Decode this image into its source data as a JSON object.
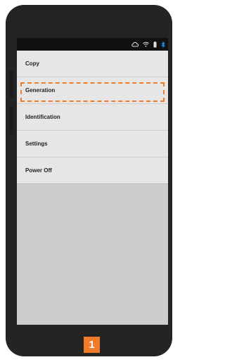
{
  "status_bar": {
    "icons": [
      "cloud-icon",
      "wifi-icon",
      "battery-icon",
      "bluetooth-icon"
    ],
    "bluetooth_color": "#2196f3"
  },
  "menu": {
    "items": [
      {
        "label": "Copy"
      },
      {
        "label": "Generation"
      },
      {
        "label": "Identification"
      },
      {
        "label": "Settings"
      },
      {
        "label": "Power Off"
      }
    ],
    "highlighted_item": "Generation",
    "highlight_color": "#f07c2a"
  },
  "step_badge": {
    "number": "1",
    "color": "#f07c2a"
  }
}
